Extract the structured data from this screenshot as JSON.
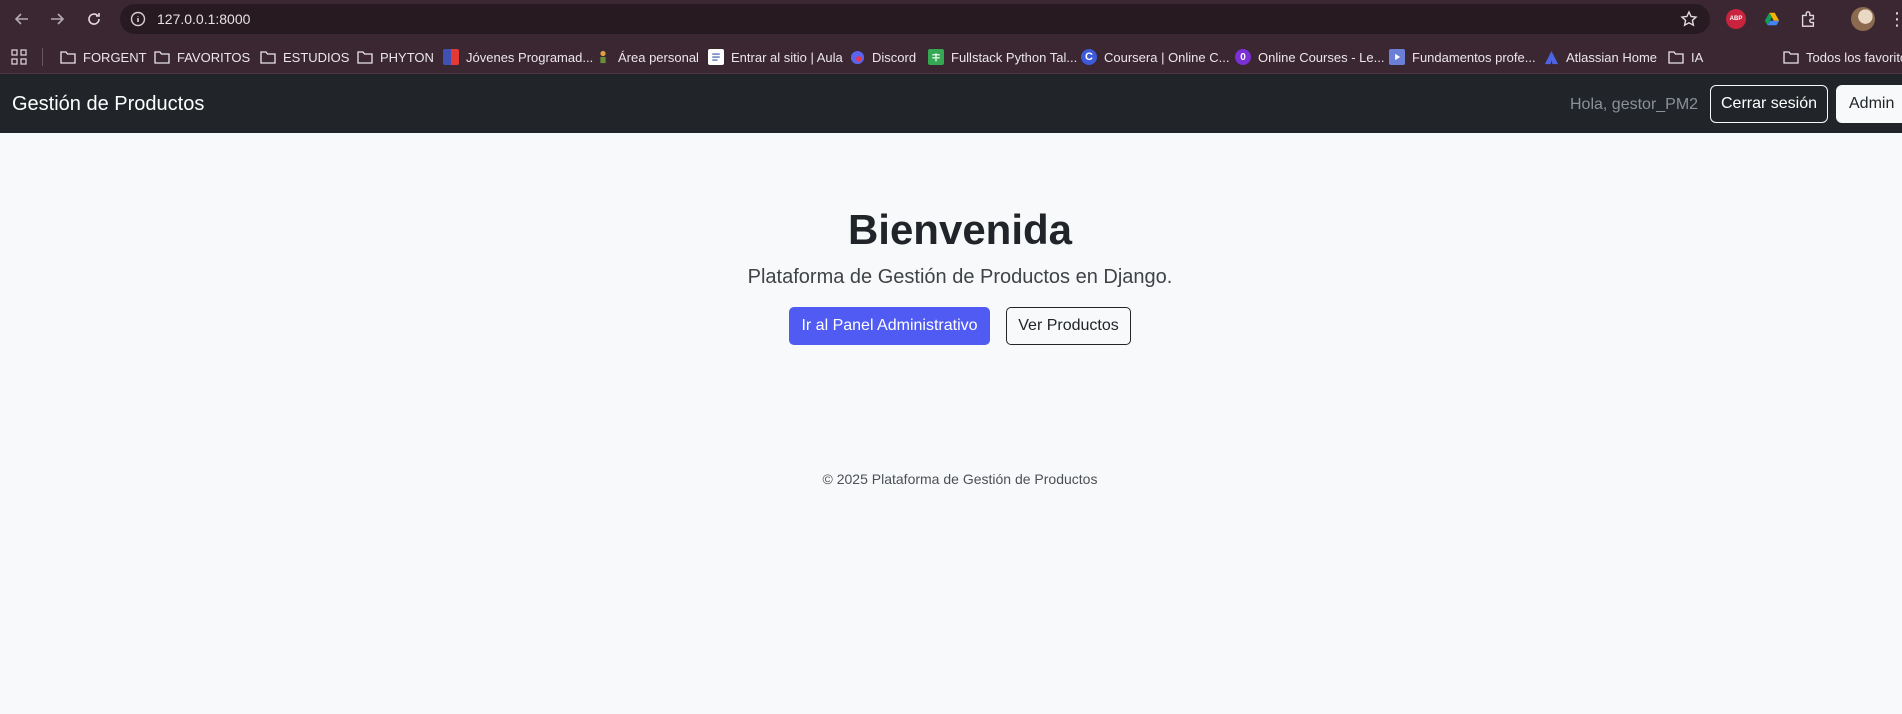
{
  "browser": {
    "url": "127.0.0.1:8000"
  },
  "bookmarks": [
    {
      "label": "FORGENT",
      "icon": "folder-icon"
    },
    {
      "label": "FAVORITOS",
      "icon": "folder-icon"
    },
    {
      "label": "ESTUDIOS",
      "icon": "folder-icon"
    },
    {
      "label": "PHYTON",
      "icon": "folder-icon"
    },
    {
      "label": "Jóvenes Programad...",
      "icon": "site-icon"
    },
    {
      "label": "Área personal",
      "icon": "site-icon"
    },
    {
      "label": "Entrar al sitio | Aula",
      "icon": "site-icon"
    },
    {
      "label": "Discord",
      "icon": "discord-icon"
    },
    {
      "label": "Fullstack Python Tal...",
      "icon": "sheets-icon"
    },
    {
      "label": "Coursera | Online C...",
      "icon": "coursera-icon"
    },
    {
      "label": "Online Courses - Le...",
      "icon": "site-icon"
    },
    {
      "label": "Fundamentos profe...",
      "icon": "site-icon"
    },
    {
      "label": "Atlassian Home",
      "icon": "atlassian-icon"
    },
    {
      "label": "IA",
      "icon": "folder-icon"
    },
    {
      "label": "Todos los favoritos",
      "icon": "folder-icon"
    }
  ],
  "navbar": {
    "brand": "Gestión de Productos",
    "greeting": "Hola, gestor_PM2",
    "logout_label": "Cerrar sesión",
    "admin_label": "Admin"
  },
  "hero": {
    "title": "Bienvenida",
    "subtitle": "Plataforma de Gestión de Productos en Django.",
    "primary_label": "Ir al Panel Administrativo",
    "secondary_label": "Ver Productos"
  },
  "footer": {
    "text": "© 2025 Plataforma de Gestión de Productos"
  },
  "colors": {
    "browser_chrome": "#3a2732",
    "navbar": "#212529",
    "primary": "#4f5bf2",
    "page_bg": "#f8f9fa"
  }
}
